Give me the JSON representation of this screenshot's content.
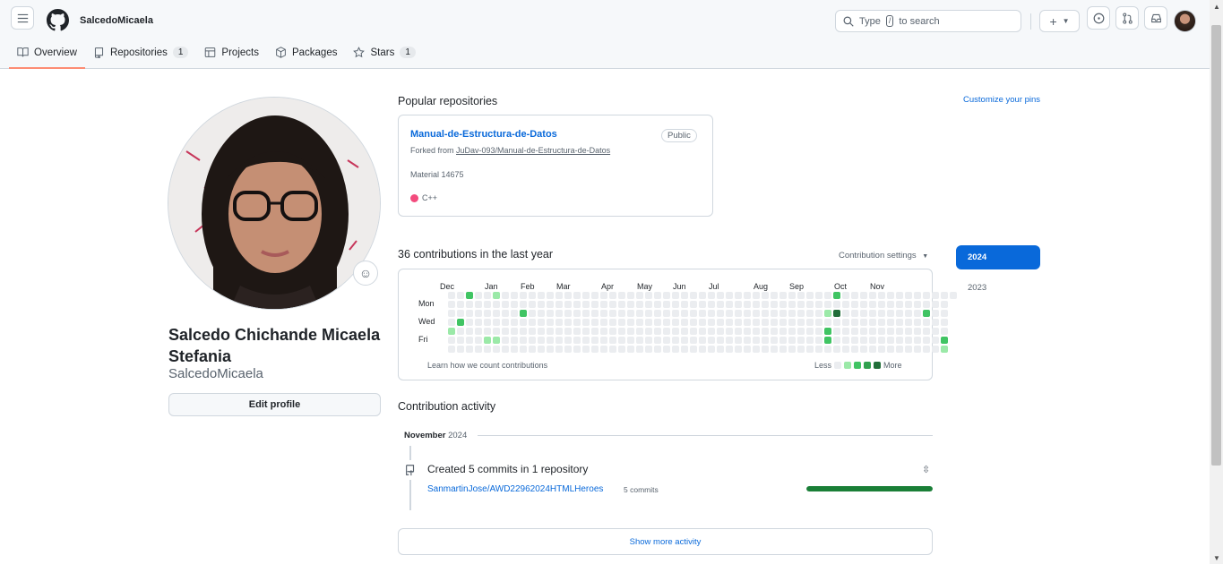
{
  "header": {
    "username": "SalcedoMicaela",
    "search_placeholder_pre": "Type",
    "search_key": "/",
    "search_placeholder_post": "to search"
  },
  "tabs": [
    {
      "label": "Overview",
      "icon": "book-icon"
    },
    {
      "label": "Repositories",
      "count": "1",
      "icon": "repo-icon"
    },
    {
      "label": "Projects",
      "icon": "table-icon"
    },
    {
      "label": "Packages",
      "icon": "package-icon"
    },
    {
      "label": "Stars",
      "count": "1",
      "icon": "star-icon"
    }
  ],
  "profile": {
    "full_name": "Salcedo Chichande Micaela Stefania",
    "login": "SalcedoMicaela",
    "edit_label": "Edit profile"
  },
  "popular": {
    "title": "Popular repositories",
    "customize_label": "Customize your pins",
    "repo": {
      "name": "Manual-de-Estructura-de-Datos",
      "visibility": "Public",
      "forked_prefix": "Forked from",
      "forked_from": "JuDav-093/Manual-de-Estructura-de-Datos",
      "description": "Material 14675",
      "language": "C++",
      "language_color": "#f34b7d"
    }
  },
  "contributions": {
    "title": "36 contributions in the last year",
    "settings_label": "Contribution settings",
    "months": [
      "Dec",
      "Jan",
      "Feb",
      "Mar",
      "Apr",
      "May",
      "Jun",
      "Jul",
      "Aug",
      "Sep",
      "Oct",
      "Nov"
    ],
    "days": [
      "Mon",
      "Wed",
      "Fri"
    ],
    "learn_label": "Learn how we count contributions",
    "legend_less": "Less",
    "legend_more": "More",
    "colors": [
      "#ebedf0",
      "#9be9a8",
      "#40c463",
      "#30a14e",
      "#216e39"
    ],
    "active_cells": [
      [
        2,
        0,
        2
      ],
      [
        5,
        0,
        1
      ],
      [
        1,
        3,
        2
      ],
      [
        0,
        4,
        1
      ],
      [
        4,
        5,
        1
      ],
      [
        5,
        5,
        1
      ],
      [
        8,
        2,
        2
      ],
      [
        7,
        7,
        1
      ],
      [
        43,
        0,
        2
      ],
      [
        43,
        2,
        4
      ],
      [
        42,
        2,
        1
      ],
      [
        42,
        4,
        2
      ],
      [
        42,
        5,
        2
      ],
      [
        41,
        7,
        2
      ],
      [
        53,
        2,
        2
      ],
      [
        55,
        5,
        2
      ],
      [
        55,
        6,
        1
      ]
    ],
    "years": [
      "2024",
      "2023"
    ],
    "selected_year": "2024"
  },
  "activity": {
    "title": "Contribution activity",
    "month": "November",
    "year": "2024",
    "item_title": "Created 5 commits in 1 repository",
    "repo": "SanmartinJose/AWD22962024HTMLHeroes",
    "commits": "5 commits",
    "bar_fraction": 1.0,
    "show_more": "Show more activity"
  }
}
